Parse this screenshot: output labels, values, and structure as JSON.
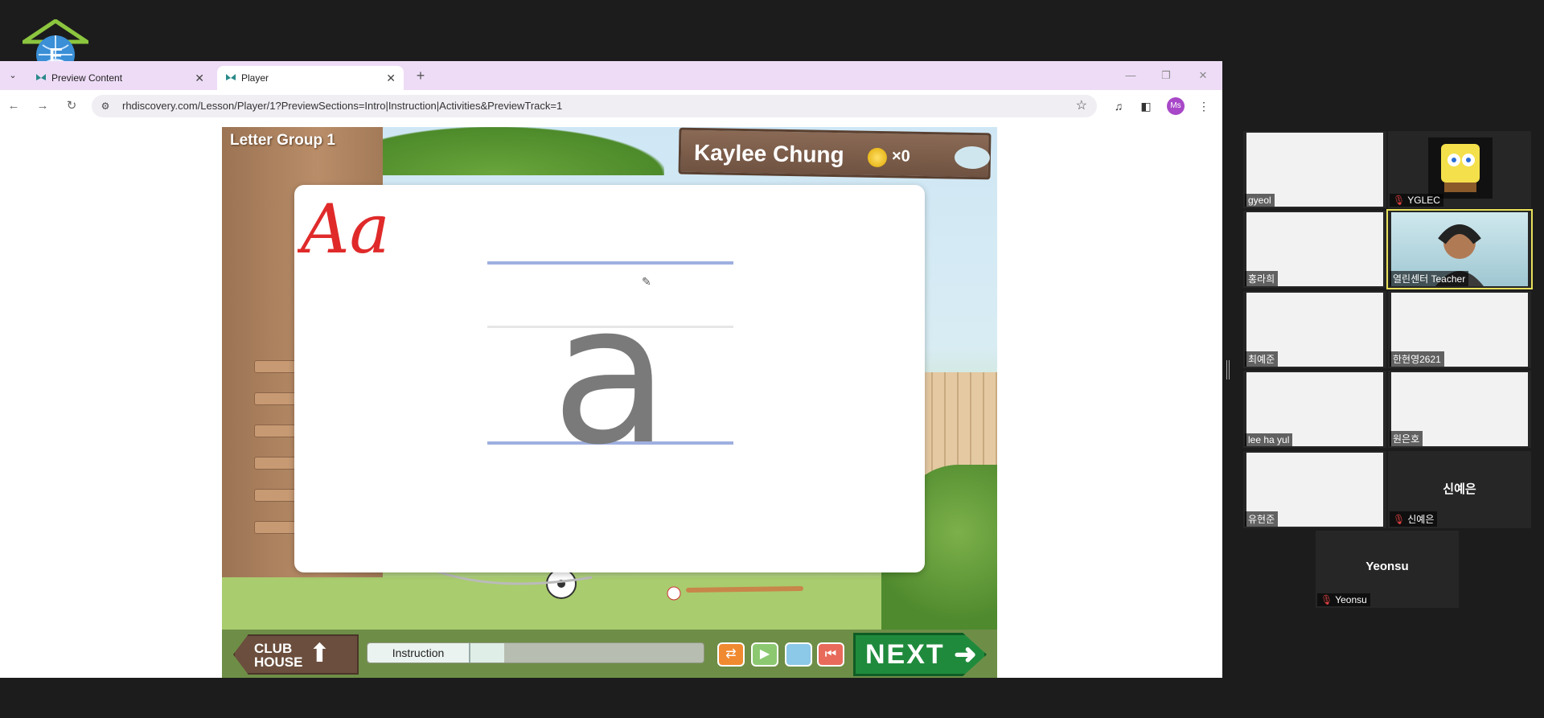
{
  "browser": {
    "tabs": [
      {
        "label": "Preview Content"
      },
      {
        "label": "Player"
      }
    ],
    "url": "rhdiscovery.com/Lesson/Player/1?PreviewSections=Intro|Instruction|Activities&PreviewTrack=1",
    "profile_initials": "Ms"
  },
  "game": {
    "group_title": "Letter Group 1",
    "player_name": "Kaylee Chung",
    "coin_count": "×0",
    "handwriting": "Aa",
    "letter": "a",
    "clubhouse_line1": "CLUB",
    "clubhouse_line2": "HOUSE",
    "progress_label": "Instruction",
    "next_label": "NEXT",
    "colors": {
      "handwriting": "#e02a2a",
      "letter": "#7a7a7a",
      "guide_line": "#9fb0e0",
      "next_button": "#1f8a3c"
    }
  },
  "participants": [
    {
      "name": "gyeol",
      "muted": false
    },
    {
      "name": "YGLEC",
      "muted": true
    },
    {
      "name": "홍라희",
      "muted": false
    },
    {
      "name": "열린센터 Teacher",
      "muted": false,
      "active_speaker": true
    },
    {
      "name": "최예준",
      "muted": false
    },
    {
      "name": "한현영2621",
      "muted": false
    },
    {
      "name": "lee ha yul",
      "muted": false
    },
    {
      "name": "원은호",
      "muted": false
    },
    {
      "name": "유현준",
      "muted": false
    },
    {
      "name": "신예은",
      "muted": true,
      "video_off": true
    },
    {
      "name": "Yeonsu",
      "muted": true,
      "video_off": true
    }
  ]
}
